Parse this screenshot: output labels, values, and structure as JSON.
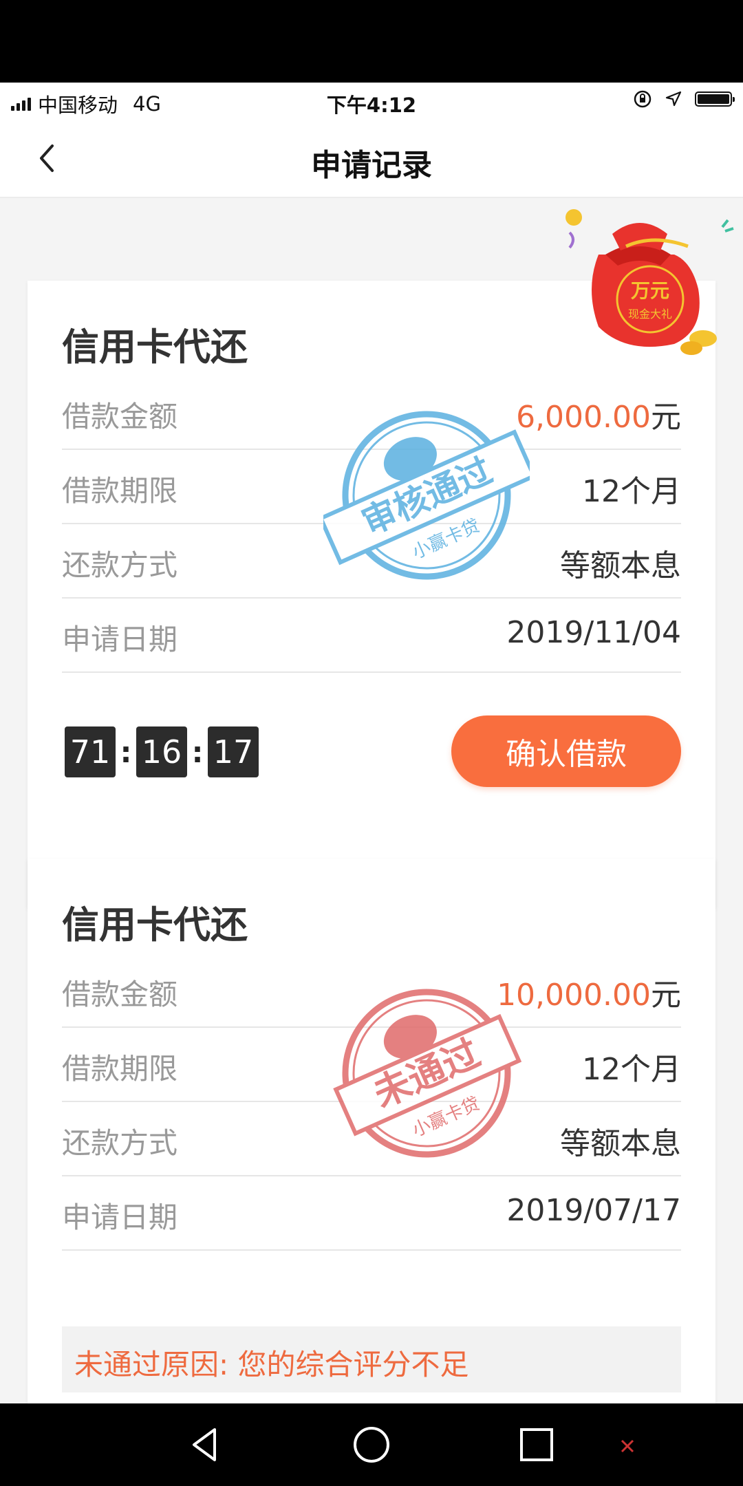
{
  "status_bar": {
    "carrier": "中国移动",
    "network": "4G",
    "time": "下午4:12"
  },
  "nav": {
    "title": "申请记录"
  },
  "promo": {
    "line1": "万元",
    "line2": "现金大礼"
  },
  "applications": [
    {
      "title": "信用卡代还",
      "rows": [
        {
          "label": "借款金额",
          "amount": "6,000.00",
          "unit": "元"
        },
        {
          "label": "借款期限",
          "value": "12个月"
        },
        {
          "label": "还款方式",
          "value": "等额本息"
        },
        {
          "label": "申请日期",
          "value": "2019/11/04"
        }
      ],
      "stamp": {
        "text": "审核通过",
        "sub": "小赢卡贷",
        "color": "#5ab0e0"
      },
      "countdown": {
        "h": "71",
        "m": "16",
        "s": "17",
        "sep": ":"
      },
      "action_label": "确认借款"
    },
    {
      "title": "信用卡代还",
      "rows": [
        {
          "label": "借款金额",
          "amount": "10,000.00",
          "unit": "元"
        },
        {
          "label": "借款期限",
          "value": "12个月"
        },
        {
          "label": "还款方式",
          "value": "等额本息"
        },
        {
          "label": "申请日期",
          "value": "2019/07/17"
        }
      ],
      "stamp": {
        "text": "未通过",
        "sub": "小赢卡贷",
        "color": "#e06a6a"
      },
      "reason": "未通过原因: 您的综合评分不足"
    }
  ],
  "colors": {
    "accent": "#f96e3e",
    "amount": "#ee6a3f",
    "background": "#f4f4f4"
  }
}
